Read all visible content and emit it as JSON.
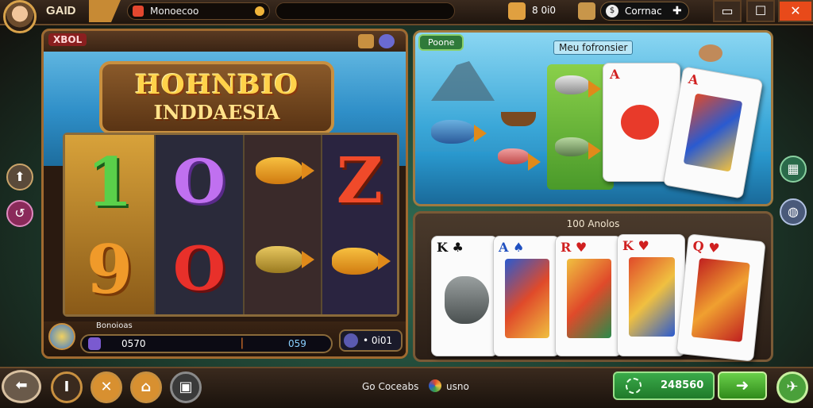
{
  "header": {
    "brand": "GAID",
    "search_text": "Monoecoo",
    "score_text": "8 0i0",
    "currency_text": "Corrnac",
    "currency_symbol": "$"
  },
  "left_panel": {
    "head_label": "XBOL",
    "logo_line1": "HOHNBIO",
    "logo_line2": "INDDAESIA",
    "reel_symbols": {
      "r1_top": "1",
      "r1_bottom": "9",
      "r2_top": "O",
      "r2_bottom": "O",
      "r4_top": "Z"
    },
    "footer_label": "Bonoioas",
    "footer_value_left": "0570",
    "footer_value_right": "059",
    "footer_counter": "• 0i01"
  },
  "right_top": {
    "tab": "Poone",
    "title": "Meu fofronsier"
  },
  "right_bottom": {
    "title": "100 Anolos",
    "cards": [
      {
        "rank": "K",
        "suit": "♣"
      },
      {
        "rank": "A",
        "suit": "♠"
      },
      {
        "rank": "R",
        "suit": "♥"
      },
      {
        "rank": "K",
        "suit": "♥"
      },
      {
        "rank": "Q",
        "suit": "♥"
      }
    ]
  },
  "bottom_bar": {
    "center_text": "Go Coceabs",
    "center_value": "usno",
    "balance": "248560"
  },
  "colors": {
    "wood": "#a06a30",
    "gold": "#c89040",
    "green_button": "#2f8a1a",
    "close_button": "#e84a1a"
  },
  "icons": [
    "back-arrow-icon",
    "info-icon",
    "tools-icon",
    "map-icon",
    "settings-icon",
    "play-arrow-icon",
    "plus-icon",
    "close-icon",
    "maximize-icon",
    "minimize-icon",
    "coin-icon",
    "gift-icon"
  ]
}
